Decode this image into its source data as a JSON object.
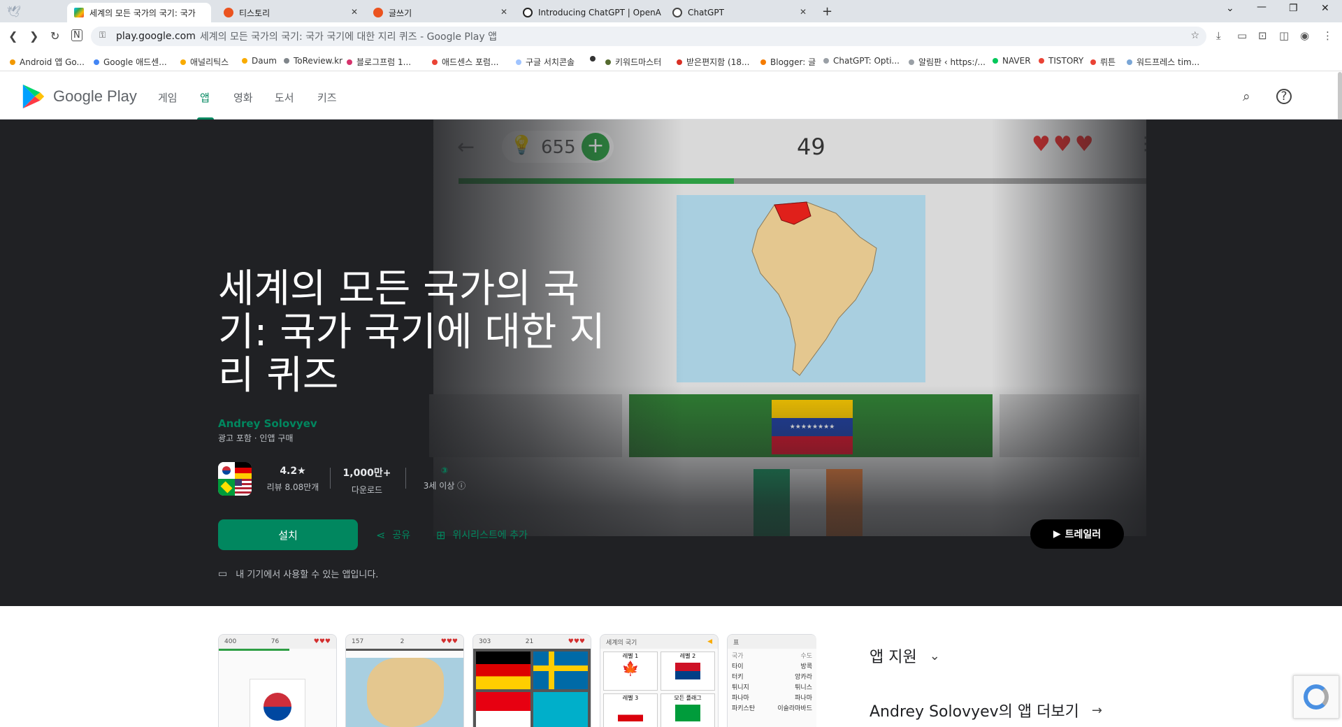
{
  "browser": {
    "tabs": [
      {
        "title": "세계의 모든 국가의 국기: 국가",
        "active": true
      },
      {
        "title": "티스토리",
        "active": false
      },
      {
        "title": "글쓰기",
        "active": false
      },
      {
        "title": "Introducing ChatGPT | OpenA",
        "active": false
      },
      {
        "title": "ChatGPT",
        "active": false
      }
    ],
    "new_tab": "+",
    "url_host": "play.google.com",
    "url_rest": "세계의 모든 국가의 국기: 국가 국기에 대한 지리 퀴즈 - Google Play 앱",
    "bookmarks": [
      {
        "label": "Android 앱 Go...",
        "color": "#f29900"
      },
      {
        "label": "Google 애드센...",
        "color": "#4285f4"
      },
      {
        "label": "애널리틱스",
        "color": "#f9ab00"
      },
      {
        "label": "Daum",
        "color": "#f9ab00"
      },
      {
        "label": "ToReview.kr",
        "color": "#80868b"
      },
      {
        "label": "블로그프럼 1...",
        "color": "#d6336c"
      },
      {
        "label": "애드센스 포럼...",
        "color": "#ea4335"
      },
      {
        "label": "구글 서치콘솔",
        "color": "#a0c4ff"
      },
      {
        "label": "",
        "color": "#333333"
      },
      {
        "label": "키워드마스터",
        "color": "#556b2f"
      },
      {
        "label": "받은편지함 (18...",
        "color": "#d93025"
      },
      {
        "label": "Blogger: 글",
        "color": "#f57c00"
      },
      {
        "label": "ChatGPT: Opti...",
        "color": "#9aa0a6"
      },
      {
        "label": "알림판 ‹ https:/...",
        "color": "#9aa0a6"
      },
      {
        "label": "NAVER",
        "color": "#03c75a"
      },
      {
        "label": "TISTORY",
        "color": "#ea4335"
      },
      {
        "label": "뤼튼",
        "color": "#ea4335"
      },
      {
        "label": "워드프레스 tim...",
        "color": "#7aa6d6"
      }
    ]
  },
  "play_header": {
    "logo_text": "Google Play",
    "nav": [
      "게임",
      "앱",
      "영화",
      "도서",
      "키즈"
    ],
    "active_nav": "앱"
  },
  "hero": {
    "title": "세계의 모든 국가의 국기: 국가 국기에 대한 지리 퀴즈",
    "developer": "Andrey Solovyev",
    "sub": "광고 포함 · 인앱 구매",
    "stats": [
      {
        "value": "4.2★",
        "label": "리뷰 8.08만개"
      },
      {
        "value": "1,000만+",
        "label": "다운로드"
      },
      {
        "value": "③",
        "label": "3세 이상 ⓘ"
      }
    ],
    "install_label": "설치",
    "share_label": "공유",
    "wishlist_label": "위시리스트에 추가",
    "trailer_label": "트레일러",
    "device_note": "내 기기에서 사용할 수 있는 앱입니다.",
    "screenshot": {
      "hints": "655",
      "score": "49"
    }
  },
  "thumbs": [
    {
      "left": "400",
      "mid": "76"
    },
    {
      "left": "157",
      "mid": "2"
    },
    {
      "left": "303",
      "mid": "21"
    },
    {
      "left": "세계의 국기",
      "mid": ""
    },
    {
      "left": "표",
      "mid": ""
    }
  ],
  "thumb4_levels": [
    "레벨 1",
    "레벨 2",
    "레벨 3",
    "모든 플래그"
  ],
  "thumb5_rows": [
    {
      "c1": "국가",
      "c2": "수도"
    },
    {
      "c1": "타이",
      "c2": "방콕"
    },
    {
      "c1": "터키",
      "c2": "앙카라"
    },
    {
      "c1": "튀니지",
      "c2": "튀니스"
    },
    {
      "c1": "파나마",
      "c2": "파나마"
    },
    {
      "c1": "파키스탄",
      "c2": "이슬라마바드"
    }
  ],
  "side": {
    "support": "앱 지원",
    "more": "Andrey Solovyev의 앱 더보기"
  },
  "colors": {
    "accent": "#01875f",
    "hero_bg": "#202124"
  }
}
